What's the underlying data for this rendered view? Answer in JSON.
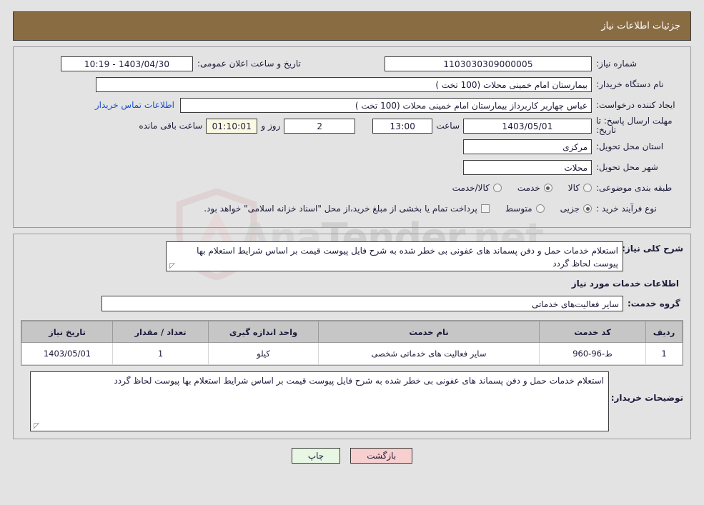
{
  "header": {
    "title": "جزئیات اطلاعات نیاز",
    "bg_color": "#8a6c43",
    "text_color": "#ffffff"
  },
  "watermark": {
    "text_part1": "Ana",
    "text_part2": "Tender",
    "text_part3": ".net",
    "icon": "shield-icon"
  },
  "form": {
    "need_number": {
      "label": "شماره نیاز:",
      "value": "1103030309000005"
    },
    "announce_datetime": {
      "label": "تاریخ و ساعت اعلان عمومی:",
      "value": "1403/04/30 - 10:19"
    },
    "buyer_org": {
      "label": "نام دستگاه خریدار:",
      "value": "بیمارستان امام خمینی محلات (100 تخت )"
    },
    "requester": {
      "label": "ایجاد کننده درخواست:",
      "value": "عباس چهاربر کاربرداز  بیمارستان امام خمینی محلات (100 تخت )",
      "contact_link": "اطلاعات تماس خریدار"
    },
    "deadline": {
      "label": "مهلت ارسال پاسخ: تا تاریخ:",
      "date": "1403/05/01",
      "time_label": "ساعت",
      "time": "13:00",
      "days": "2",
      "days_label": "روز و",
      "timer": "01:10:01",
      "timer_label": "ساعت باقی مانده"
    },
    "delivery_province": {
      "label": "استان محل تحویل:",
      "value": "مرکزی"
    },
    "delivery_city": {
      "label": "شهر محل تحویل:",
      "value": "محلات"
    },
    "classification": {
      "label": "طبقه بندی موضوعی:",
      "options": [
        {
          "label": "کالا",
          "selected": false
        },
        {
          "label": "خدمت",
          "selected": true
        },
        {
          "label": "کالا/خدمت",
          "selected": false
        }
      ]
    },
    "purchase_process": {
      "label": "نوع فرآیند خرید :",
      "options": [
        {
          "label": "جزیی",
          "selected": true
        },
        {
          "label": "متوسط",
          "selected": false
        }
      ],
      "checkbox_label": "پرداخت تمام یا بخشی از مبلغ خرید،از محل \"اسناد خزانه اسلامی\" خواهد بود.",
      "checkbox_checked": false
    }
  },
  "summary": {
    "label": "شرح کلی نیاز:",
    "value": "استعلام خدمات حمل و دفن پسماند های عفونی بی خطر شده به شرح فایل پیوست قیمت بر اساس شرایط استعلام بها پیوست لحاظ گردد"
  },
  "services_section": {
    "title": "اطلاعات خدمات مورد نیاز",
    "service_group": {
      "label": "گروه خدمت:",
      "value": "سایر فعالیت‌های خدماتی"
    },
    "table": {
      "headers": [
        "ردیف",
        "کد خدمت",
        "نام خدمت",
        "واحد اندازه گیری",
        "تعداد / مقدار",
        "تاریخ نیاز"
      ],
      "rows": [
        {
          "index": "1",
          "code": "ط-96-960",
          "name": "سایر فعالیت های خدماتی شخصی",
          "unit": "کیلو",
          "quantity": "1",
          "need_date": "1403/05/01"
        }
      ]
    }
  },
  "buyer_notes": {
    "label": "توضیحات خریدار:",
    "value": "استعلام خدمات حمل و دفن پسماند های عفونی بی خطر شده به شرح فایل پیوست قیمت بر اساس شرایط استعلام بها پیوست لحاظ گردد"
  },
  "footer": {
    "print_label": "چاپ",
    "back_label": "بازگشت",
    "print_color": "#e8f6e4",
    "back_color": "#f7cfcf"
  }
}
